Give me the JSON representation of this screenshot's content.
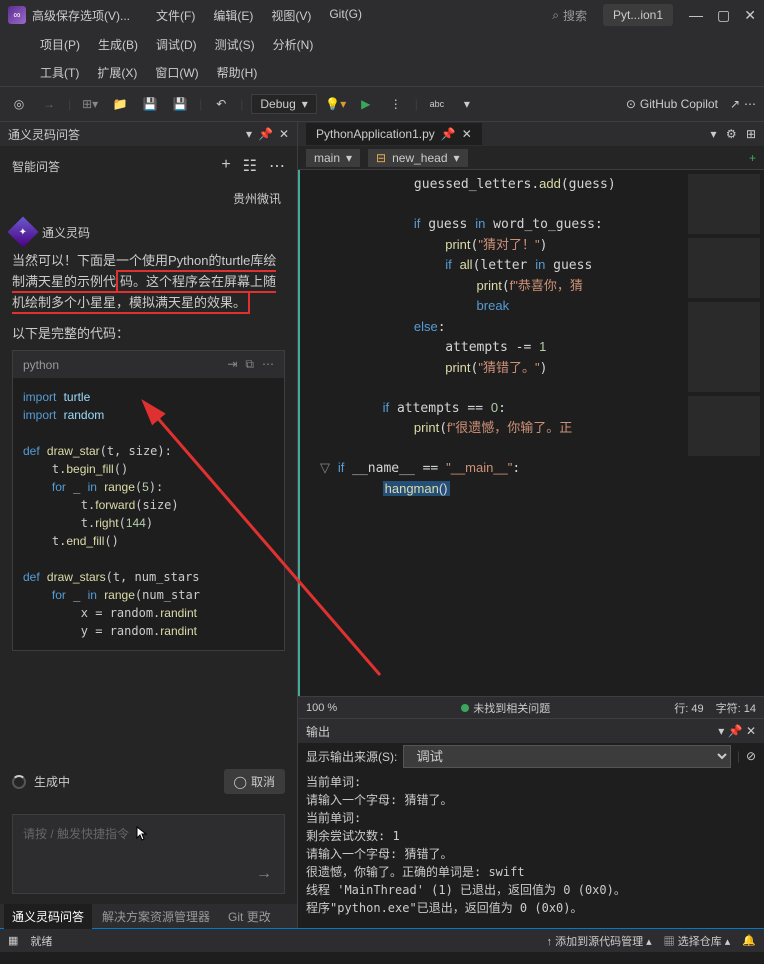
{
  "titlebar": {
    "title": "高级保存选项(V)...",
    "search": "搜索",
    "openTab": "Pyt...ion1"
  },
  "menus": {
    "row1": [
      "文件(F)",
      "编辑(E)",
      "视图(V)",
      "Git(G)"
    ],
    "row2": [
      "项目(P)",
      "生成(B)",
      "调试(D)",
      "测试(S)",
      "分析(N)"
    ],
    "row3": [
      "工具(T)",
      "扩展(X)",
      "窗口(W)",
      "帮助(H)"
    ]
  },
  "toolbar": {
    "debug": "Debug",
    "copilot": "GitHub Copilot"
  },
  "leftPanel": {
    "header": "通义灵码问答",
    "qaTitle": "智能问答",
    "guizhou": "贵州微讯",
    "botName": "通义灵码",
    "desc1": "当然可以！下面是一个使用Python的turtle库绘制满天星的示例代",
    "desc2": "码。这个程序会在屏幕上随机绘制多个小星星，模拟满天星的效果。",
    "codeTitle": "以下是完整的代码：",
    "codeLang": "python",
    "code": "import turtle\nimport random\n\ndef draw_star(t, size):\n    t.begin_fill()\n    for _ in range(5):\n        t.forward(size)\n        t.right(144)\n    t.end_fill()\n\ndef draw_stars(t, num_stars\n    for _ in range(num_star\n        x = random.randint\n        y = random.randint",
    "generating": "生成中",
    "cancel": "取消",
    "placeholder": "请按 / 触发快捷指令",
    "tabs": [
      "通义灵码问答",
      "解决方案资源管理器",
      "Git 更改"
    ]
  },
  "editor": {
    "filename": "PythonApplication1.py",
    "navMain": "main",
    "navFunc": "new_head",
    "zoom": "100 %",
    "noissues": "未找到相关问题",
    "lineInfo": "行: 49",
    "charInfo": "字符: 14"
  },
  "output": {
    "title": "输出",
    "sourceLabel": "显示输出来源(S):",
    "source": "调试",
    "body": "当前单词:\n请输入一个字母: 猜错了。\n当前单词:\n剩余尝试次数: 1\n请输入一个字母: 猜错了。\n很遗憾，你输了。正确的单词是: swift\n线程 'MainThread' (1) 已退出，返回值为 0 (0x0)。\n程序\"python.exe\"已退出，返回值为 0 (0x0)。"
  },
  "bottom": {
    "ready": "就绪",
    "addSrc": "添加到源代码管理",
    "selectRepo": "选择仓库"
  }
}
